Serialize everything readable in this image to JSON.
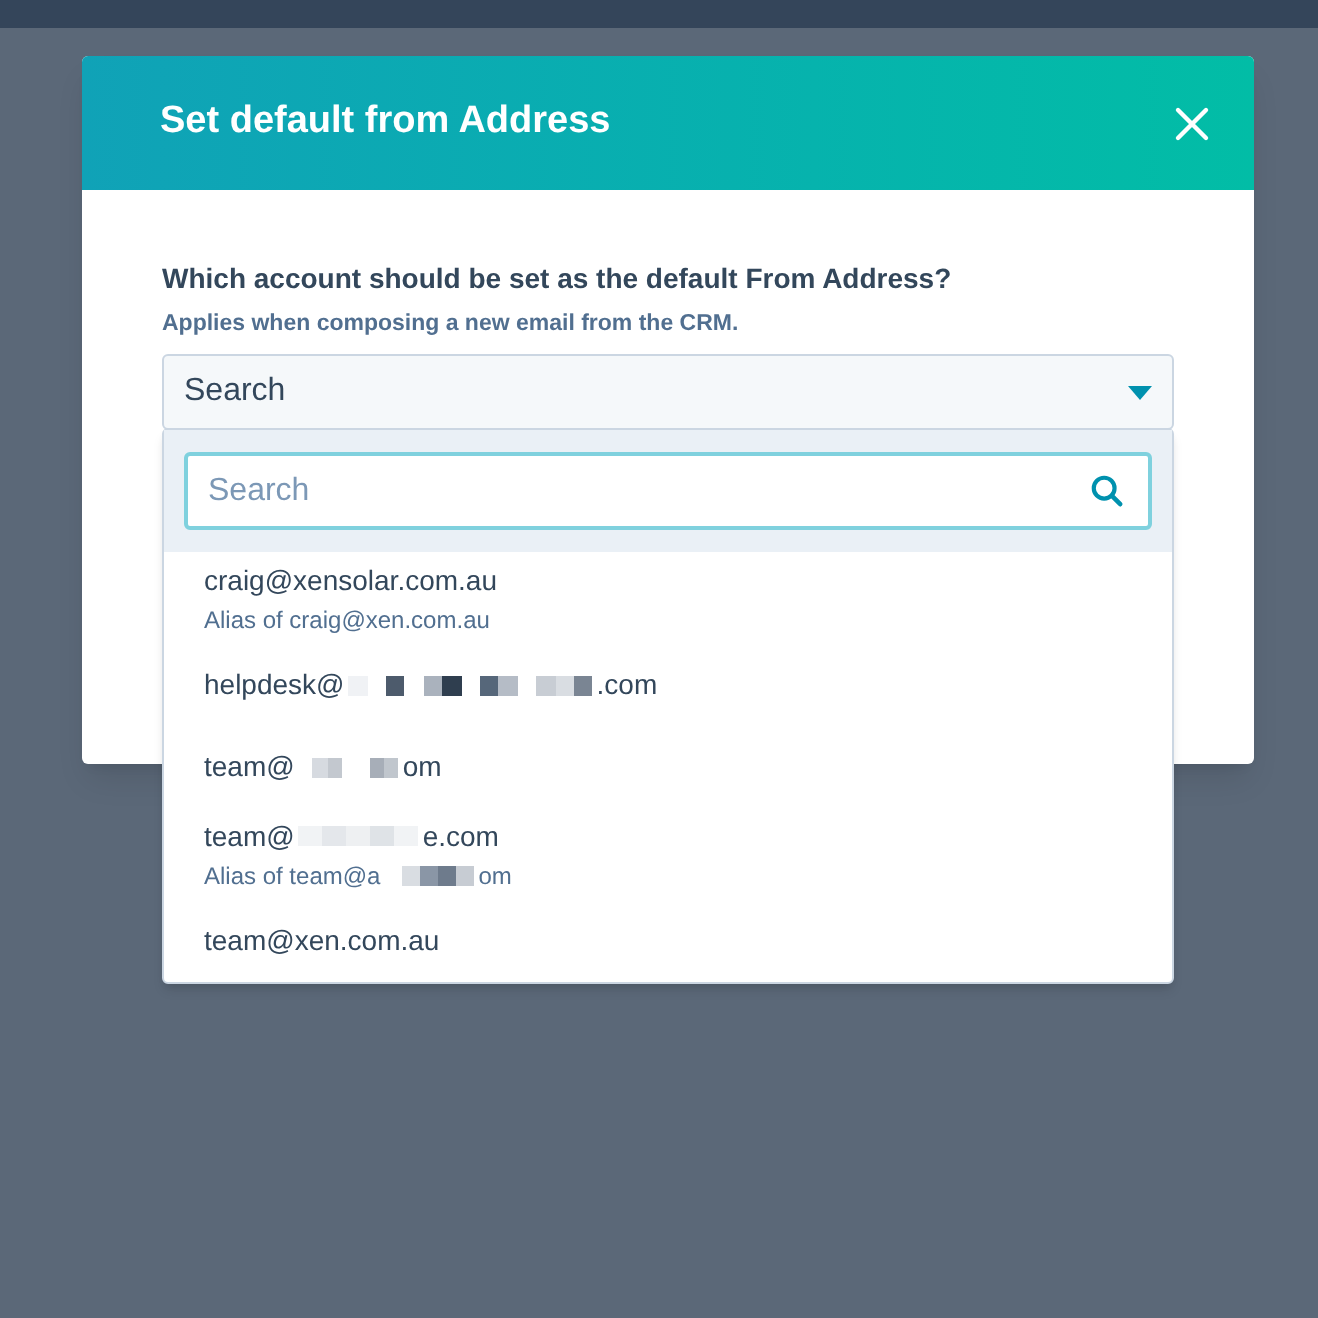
{
  "dialog": {
    "title": "Set default from Address",
    "question": "Which account should be set as the default From Address?",
    "hint": "Applies when composing a new email from the CRM.",
    "select": {
      "value": "Search",
      "expanded": true
    }
  },
  "dropdown": {
    "search": {
      "placeholder": "Search"
    },
    "options": [
      {
        "address": "craig@xensolar.com.au",
        "alias": "Alias of craig@xen.com.au"
      },
      {
        "address": "helpdesk@",
        "address_end": ".com",
        "redacted": true
      },
      {
        "address": "team@",
        "address_end": "om",
        "redacted": true
      },
      {
        "address": "team@",
        "address_end": "e.com",
        "redacted": true,
        "alias": "Alias of team@a",
        "alias_end": "om"
      },
      {
        "address": "team@xen.com.au"
      }
    ]
  }
}
